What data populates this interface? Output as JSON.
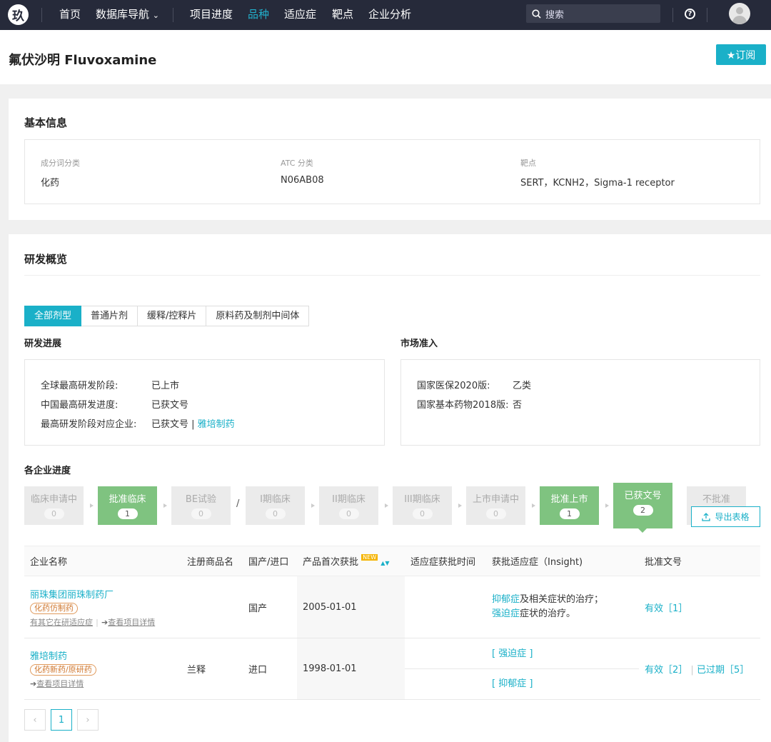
{
  "nav": {
    "logo": "玖",
    "items": [
      "首页",
      "数据库导航",
      "项目进度",
      "品种",
      "适应症",
      "靶点",
      "企业分析"
    ],
    "dropdown_arrow": "⌄",
    "search_placeholder": "搜索",
    "help": "?",
    "accent_color": "#1ab0c8"
  },
  "header": {
    "title": "氟伏沙明 Fluvoxamine",
    "subscribe": "★订阅"
  },
  "basic": {
    "title": "基本信息",
    "fields": [
      {
        "label": "成分词分类",
        "value": "化药"
      },
      {
        "label": "ATC 分类",
        "value": "N06AB08"
      },
      {
        "label": "靶点",
        "value": "SERT，KCNH2，Sigma-1 receptor"
      }
    ]
  },
  "overview": {
    "title": "研发概览",
    "tabs": [
      "全部剂型",
      "普通片剂",
      "缓释/控释片",
      "原料药及制剂中间体"
    ],
    "progress": {
      "title": "研发进展",
      "rows": [
        {
          "label": "全球最高研发阶段:",
          "value": "已上市"
        },
        {
          "label": "中国最高研发进度:",
          "value": "已获文号"
        },
        {
          "label": "最高研发阶段对应企业:",
          "value": "已获文号 | ",
          "link": "雅培制药"
        }
      ]
    },
    "market": {
      "title": "市场准入",
      "rows": [
        {
          "label": "国家医保2020版:",
          "link": "乙类"
        },
        {
          "label": "国家基本药物2018版:",
          "value": "否"
        }
      ]
    },
    "company_progress": {
      "title": "各企业进度",
      "stages": [
        {
          "name": "临床申请中",
          "count": "0"
        },
        {
          "name": "批准临床",
          "count": "1"
        },
        {
          "name": "BE试验",
          "count": "0"
        },
        {
          "name": "I期临床",
          "count": "0"
        },
        {
          "name": "II期临床",
          "count": "0"
        },
        {
          "name": "III期临床",
          "count": "0"
        },
        {
          "name": "上市申请中",
          "count": "0"
        },
        {
          "name": "批准上市",
          "count": "1"
        },
        {
          "name": "已获文号",
          "count": "2"
        },
        {
          "name": "不批准",
          "count": ""
        }
      ],
      "slash": "/",
      "export": "导出表格"
    },
    "table": {
      "headers": [
        "企业名称",
        "注册商品名",
        "国产/进口",
        "产品首次获批",
        "适应症获批时间",
        "获批适应症（Insight)",
        "批准文号"
      ],
      "new_badge": "NEW",
      "rows": [
        {
          "company": "丽珠集团丽珠制药厂",
          "tag": "化药仿制药",
          "links": [
            "有其它在研适应症",
            "查看项目详情"
          ],
          "brand": "",
          "origin": "国产",
          "first": "2005-01-01",
          "ind_time": "",
          "ind1_link": "抑郁症",
          "ind1_text": "及相关症状的治疗；",
          "ind2_link": "强迫症",
          "ind2_text": "症状的治疗。",
          "approval": "有效［1］"
        },
        {
          "company": "雅培制药",
          "tag": "化药新药/原研药",
          "links": [
            "查看项目详情"
          ],
          "brand": "兰释",
          "origin": "进口",
          "first": "1998-01-01",
          "ind_a": "[ 强迫症 ]",
          "ind_b": "[ 抑郁症 ]",
          "approval_a": "有效［2］",
          "approval_b": "已过期［5］"
        }
      ]
    },
    "pagination": {
      "prev": "‹",
      "page": "1",
      "next": "›"
    }
  }
}
